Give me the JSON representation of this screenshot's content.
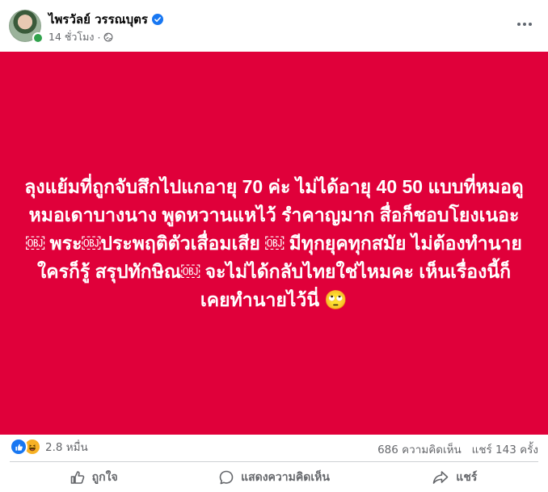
{
  "post": {
    "author_name": "ไพรวัลย์ วรรณบุตร",
    "time_ago": "14 ชั่วโมง",
    "meta_separator": "·",
    "privacy_icon": "globe-icon",
    "verified_icon": "verified-badge-icon",
    "more_icon": "more-options-icon",
    "background_color": "#e0003a",
    "text": "ลุงแย้มที่ถูกจับสึกไปแกอายุ 70 ค่ะ ไม่ได้อายุ 40 50 แบบที่หมอดูหมอเดาบางนาง พูดหวานแหไว้ รำคาญมาก สื่อก็ชอบโยงเนอะ ￼ พระ￼ประพฤติตัวเสื่อมเสีย ￼ มีทุกยุคทุกสมัย ไม่ต้องทำนาย ใครก็รู้ สรุปทักษิณ￼ จะไม่ได้กลับไทยใช่ไหมคะ เห็นเรื่องนี้ก็เคยทำนายไว้นี่ 🙄"
  },
  "stats": {
    "reaction_icons": [
      "like-reaction-icon",
      "haha-reaction-icon"
    ],
    "reaction_count": "2.8 หมื่น",
    "comments": "686 ความคิดเห็น",
    "shares": "แชร์ 143 ครั้ง"
  },
  "actions": {
    "like": "ถูกใจ",
    "comment": "แสดงความคิดเห็น",
    "share": "แชร์"
  },
  "colors": {
    "accent": "#1877f2",
    "muted_text": "#65676b",
    "online": "#31a24c"
  }
}
